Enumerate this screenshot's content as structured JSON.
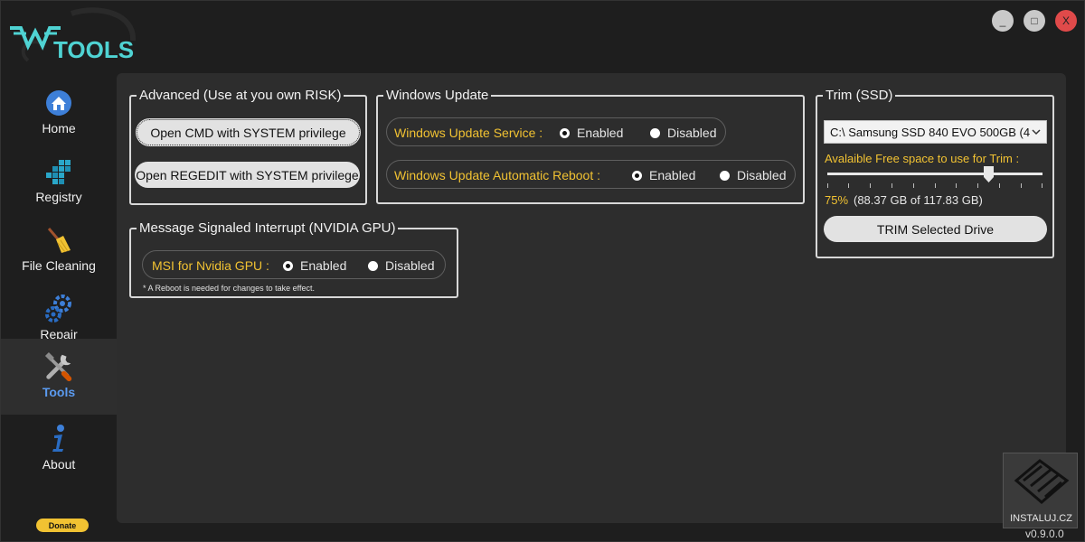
{
  "app": {
    "logo_text": "TOOLS",
    "version": "v0.9.0.0",
    "accent_color": "#5b9bf0",
    "label_color": "#f1c232"
  },
  "window_controls": {
    "minimize": "_",
    "maximize": "□",
    "close": "X"
  },
  "sidebar": {
    "items": [
      {
        "label": "Home",
        "icon": "home-icon"
      },
      {
        "label": "Registry",
        "icon": "registry-icon"
      },
      {
        "label": "File Cleaning",
        "icon": "broom-icon"
      },
      {
        "label": "Repair",
        "icon": "gears-icon"
      },
      {
        "label": "Tools",
        "icon": "tools-icon",
        "active": true
      },
      {
        "label": "About",
        "icon": "info-icon"
      }
    ],
    "donate": "Donate"
  },
  "advanced": {
    "title": "Advanced (Use at you own RISK)",
    "cmd_button": "Open CMD with SYSTEM privilege",
    "regedit_button": "Open REGEDIT with SYSTEM privilege"
  },
  "windows_update": {
    "title": "Windows Update",
    "service": {
      "label": "Windows Update Service :",
      "enabled": "Enabled",
      "disabled": "Disabled",
      "selected": "Enabled"
    },
    "reboot": {
      "label": "Windows Update Automatic Reboot :",
      "enabled": "Enabled",
      "disabled": "Disabled",
      "selected": "Enabled"
    }
  },
  "msi": {
    "title": "Message Signaled Interrupt (NVIDIA GPU)",
    "label": "MSI for Nvidia GPU :",
    "enabled": "Enabled",
    "disabled": "Disabled",
    "selected": "Enabled",
    "note": "* A Reboot is needed for changes to take effect."
  },
  "trim": {
    "title": "Trim (SSD)",
    "drive": "C:\\ Samsung SSD 840 EVO 500GB (4",
    "free_space_label": "Avalaible Free space to use for Trim :",
    "percent": "75%",
    "percent_value": 0.75,
    "size_text": "(88.37 GB of 117.83 GB)",
    "button": "TRIM Selected Drive"
  },
  "watermark": {
    "text": "INSTALUJ.CZ"
  }
}
